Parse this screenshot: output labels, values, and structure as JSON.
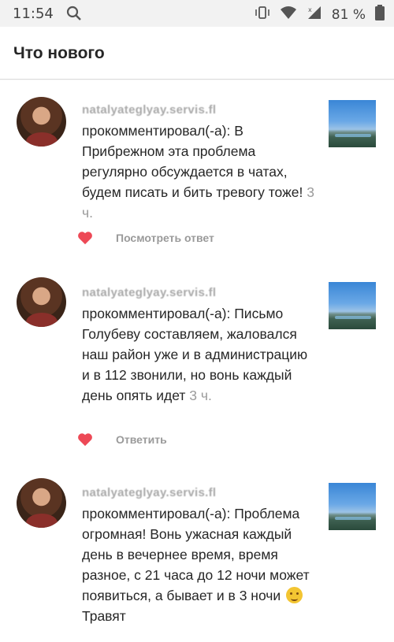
{
  "status_bar": {
    "time": "11:54",
    "battery": "81 %",
    "icons": [
      "search-icon",
      "vibrate-icon",
      "wifi-icon",
      "signal-icon",
      "battery-icon"
    ]
  },
  "header": {
    "title": "Что нового"
  },
  "colors": {
    "heart": "#ed4956",
    "secondary_text": "#9a9a9a",
    "status_bar_bg": "#f2f2f2"
  },
  "items": [
    {
      "username": "natalyateglyay.servis.fl",
      "comment": "прокомментировал(-а): В Прибрежном эта проблема регулярно обсуждается в чатах, будем писать и бить тревогу тоже!",
      "time": "3 ч.",
      "action": "Посмотреть ответ"
    },
    {
      "username": "natalyateglyay.servis.fl",
      "comment": "прокомментировал(-а): Письмо Голубеву составляем, жаловался наш район уже и в администрацию и в 112 звонили, но вонь каждый день опять идет",
      "time": "3 ч.",
      "action": "Ответить"
    },
    {
      "username": "natalyateglyay.servis.fl",
      "comment": "прокомментировал(-а): Проблема огромная! Вонь ужасная каждый день в вечернее время, время разное, с 21 часа до 12 ночи может появиться, а бывает и в 3 ночи",
      "comment_tail": "Травят"
    }
  ]
}
